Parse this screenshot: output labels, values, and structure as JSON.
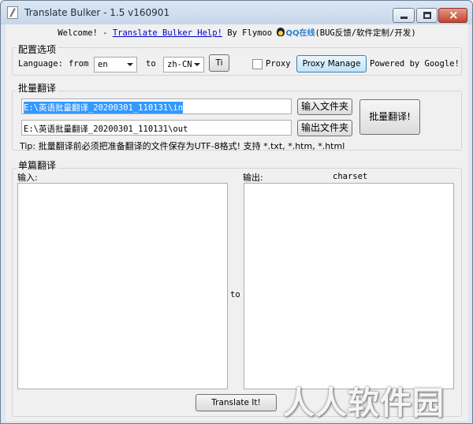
{
  "window": {
    "title": "Translate Bulker - 1.5 v160901"
  },
  "welcome": {
    "prefix": "Welcome! - ",
    "link_text": "Translate Bulker Help!",
    "by_text": " By Flymoo ",
    "qq_text": "QQ在线",
    "suffix": "(BUG反馈/软件定制/开发)"
  },
  "config": {
    "group_title": "配置选项",
    "language_label": "Language:",
    "from_label": "from",
    "from_value": "en",
    "to_label": "to",
    "to_value": "zh-CN",
    "ti_button": "Ti",
    "proxy_label": "Proxy",
    "proxy_checked": false,
    "proxy_manage_button": "Proxy Manage",
    "powered_by": "Powered by Google!"
  },
  "batch": {
    "group_title": "批量翻译",
    "input_path": "E:\\英语批量翻译_20200301_110131\\in",
    "output_path": "E:\\英语批量翻译_20200301_110131\\out",
    "input_folder_button": "输入文件夹",
    "output_folder_button": "输出文件夹",
    "batch_translate_button": "批量翻译!",
    "tip": "Tip: 批量翻译前必须把准备翻译的文件保存为UTF-8格式! 支持 *.txt, *.htm, *.html"
  },
  "single": {
    "group_title": "单篇翻译",
    "input_label": "输入:",
    "output_label": "输出:",
    "charset_label": "charset",
    "to_label": "to",
    "input_text": "",
    "output_text": "",
    "translate_button": "Translate It!"
  },
  "watermark": {
    "text": "人人软件园"
  }
}
